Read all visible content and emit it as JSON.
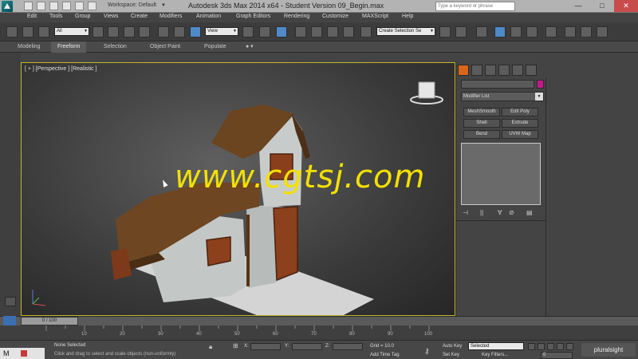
{
  "titlebar": {
    "workspace": "Workspace: Default",
    "title": "Autodesk 3ds Max  2014 x64  - Student Version  09_Begin.max",
    "search_placeholder": "Type a keyword or phrase",
    "minimize": "—",
    "maximize": "□",
    "close": "✕"
  },
  "menu": [
    "Edit",
    "Tools",
    "Group",
    "Views",
    "Create",
    "Modifiers",
    "Animation",
    "Graph Editors",
    "Rendering",
    "Customize",
    "MAXScript",
    "Help"
  ],
  "toolbar": {
    "selection_filter": "All",
    "coord_system": "View",
    "named_selection": "Create Selection Se"
  },
  "ribbon": {
    "tabs": [
      "Modeling",
      "Freeform",
      "Selection",
      "Object Paint",
      "Populate"
    ],
    "active": "Freeform"
  },
  "viewport": {
    "label": "[ + ] [Perspective ] [Realistic ]",
    "watermark": "www.cgtsj.com"
  },
  "cmdpanel": {
    "modifier_list": "Modifier List",
    "buttons": [
      "MeshSmooth",
      "Edit Poly",
      "Shell",
      "Extrude",
      "Bend",
      "UVW Map"
    ]
  },
  "timeline": {
    "position": "0 / 100",
    "ticks": [
      "10",
      "20",
      "30",
      "40",
      "50",
      "60",
      "70",
      "80",
      "90",
      "100"
    ]
  },
  "statusbar": {
    "selection": "None Selected",
    "prompt": "Click and drag to select and scale objects (non-uniformly)",
    "x_label": "X:",
    "y_label": "Y:",
    "z_label": "Z:",
    "grid": "Grid = 10.0",
    "add_time_tag": "Add Time Tag",
    "auto_key": "Auto Key",
    "set_key": "Set Key",
    "selected": "Selected",
    "key_filters": "Key Filters...",
    "frame": "0"
  },
  "taskbar": {
    "app_letter": "M"
  },
  "brand": "pluralsight",
  "colors": {
    "accent": "#4e8ac8",
    "viewport_border": "#c8b42a",
    "object_color": "#c2198a",
    "watermark": "#f4e000"
  }
}
